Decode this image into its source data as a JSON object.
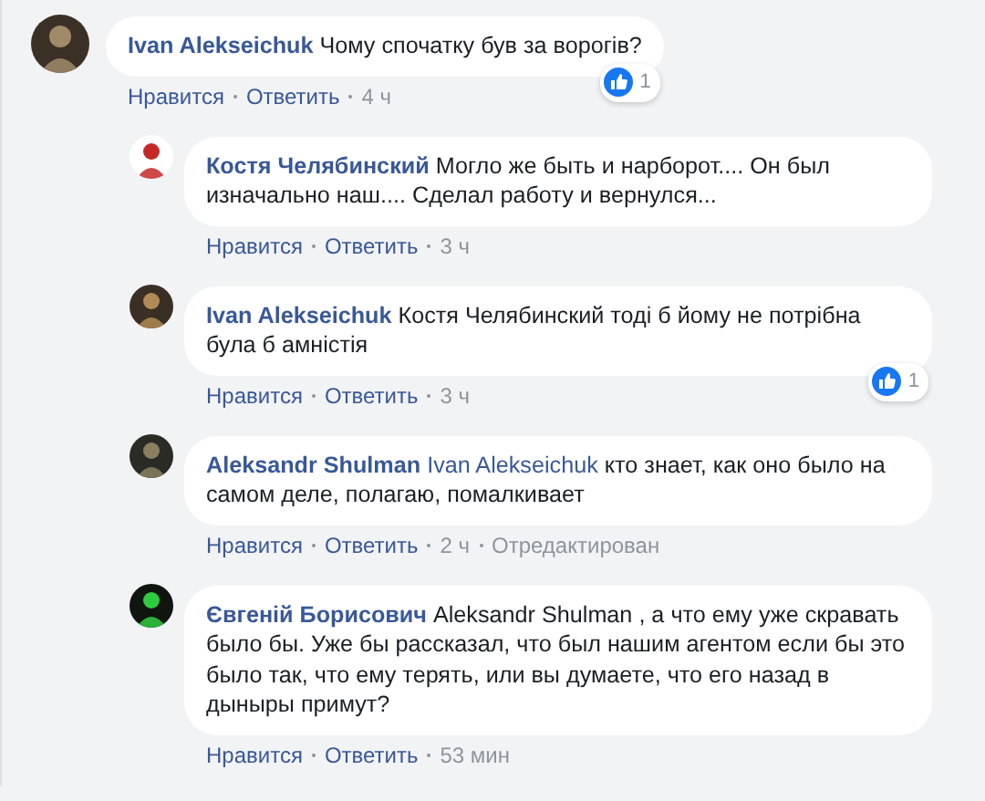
{
  "comments": [
    {
      "author": "Ivan Alekseichuk",
      "text": "Чому спочатку був за ворогів?",
      "actions": [
        "Нравится",
        "Ответить"
      ],
      "time": "4 ч",
      "reactions": {
        "count": "1"
      },
      "children": [
        {
          "author": "Костя Челябинский",
          "text": "Могло же быть и нарборот.... Он был изначально наш.... Сделал работу и вернулся...",
          "actions": [
            "Нравится",
            "Ответить"
          ],
          "time": "3 ч"
        },
        {
          "author": "Ivan Alekseichuk",
          "text": "Костя Челябинский тоді б йому не потрібна була б амністія",
          "actions": [
            "Нравится",
            "Ответить"
          ],
          "time": "3 ч",
          "reactions": {
            "count": "1"
          }
        },
        {
          "author": "Aleksandr Shulman",
          "mention": "Ivan Alekseichuk",
          "text": "кто знает, как оно было на самом деле, полагаю, помалкивает",
          "actions": [
            "Нравится",
            "Ответить"
          ],
          "time": "2 ч",
          "edited": "Отредактирован"
        },
        {
          "author": "Євгеній Борисович",
          "text": "Aleksandr Shulman , а что ему уже скравать было бы. Уже бы рассказал, что был нашим агентом если бы это было так, что ему терять, или вы думаете, что его назад в дыныры примут?",
          "actions": [
            "Нравится",
            "Ответить"
          ],
          "time": "53 мин"
        }
      ]
    }
  ]
}
